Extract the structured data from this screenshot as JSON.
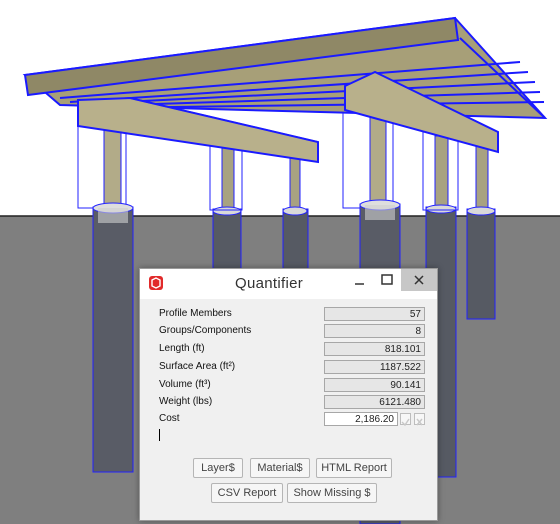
{
  "dialog": {
    "title": "Quantifier",
    "rows": [
      {
        "label": "Profile Members",
        "value": "57"
      },
      {
        "label": "Groups/Components",
        "value": "8"
      },
      {
        "label": "Length (ft)",
        "value": "818.101"
      },
      {
        "label": "Surface Area (ft²)",
        "value": "1187.522"
      },
      {
        "label": "Volume (ft³)",
        "value": "90.141"
      },
      {
        "label": "Weight (lbs)",
        "value": "6121.480"
      },
      {
        "label": "Cost",
        "value": "2,186.20"
      }
    ],
    "buttons": {
      "layer": "Layer$",
      "material": "Material$",
      "html_report": "HTML Report",
      "csv_report": "CSV Report",
      "show_missing": "Show Missing $"
    }
  },
  "icons": [
    "sketchup-icon",
    "minimize-icon",
    "maximize-icon",
    "close-icon",
    "check-icon",
    "cancel-icon"
  ],
  "colors": {
    "selection": "#1a1aff",
    "highlight": "#7a151b",
    "wood": "#a39b73",
    "concrete": "#55585f",
    "ground": "#808080"
  }
}
